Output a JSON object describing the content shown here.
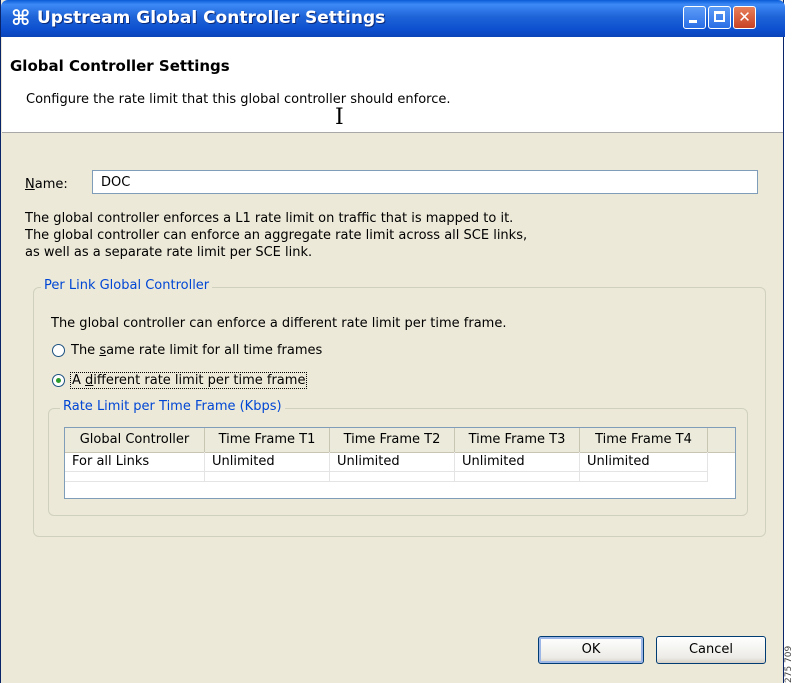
{
  "window": {
    "title_icon": "⌘",
    "title": "Upstream Global Controller Settings",
    "controls": [
      "minimize-icon",
      "maximize-icon",
      "close-icon"
    ]
  },
  "header": {
    "title": "Global Controller Settings",
    "description": "Configure the rate limit that this global controller should enforce."
  },
  "name_field": {
    "label_underlined": "N",
    "label_rest": "ame:",
    "value": "DOC"
  },
  "info": {
    "line1": "The global controller enforces a L1 rate limit on traffic that is mapped to it.",
    "line2": "The global controller can enforce an aggregate rate limit across all SCE links,",
    "line3": "as well as a separate rate limit per SCE link."
  },
  "per_link_group": {
    "legend": "Per Link Global Controller",
    "description": "The global controller can enforce a different rate limit per time frame.",
    "options": [
      {
        "pre": "The ",
        "mnemonic": "s",
        "post": "ame rate limit for all time frames",
        "checked": false
      },
      {
        "pre": "A ",
        "mnemonic": "d",
        "post": "ifferent rate limit per time frame",
        "checked": true
      }
    ]
  },
  "rate_group": {
    "legend": "Rate Limit per Time Frame (Kbps)",
    "columns": [
      "Global Controller",
      "Time Frame T1",
      "Time Frame T2",
      "Time Frame T3",
      "Time Frame T4"
    ],
    "rows": [
      [
        "For all Links",
        "Unlimited",
        "Unlimited",
        "Unlimited",
        "Unlimited"
      ]
    ]
  },
  "buttons": {
    "ok": "OK",
    "cancel": "Cancel"
  },
  "side_code": "275 709",
  "colors": {
    "titlebar": "#0a5bd7",
    "group_legend": "#0046d5",
    "dialog_bg": "#ece9d8"
  }
}
